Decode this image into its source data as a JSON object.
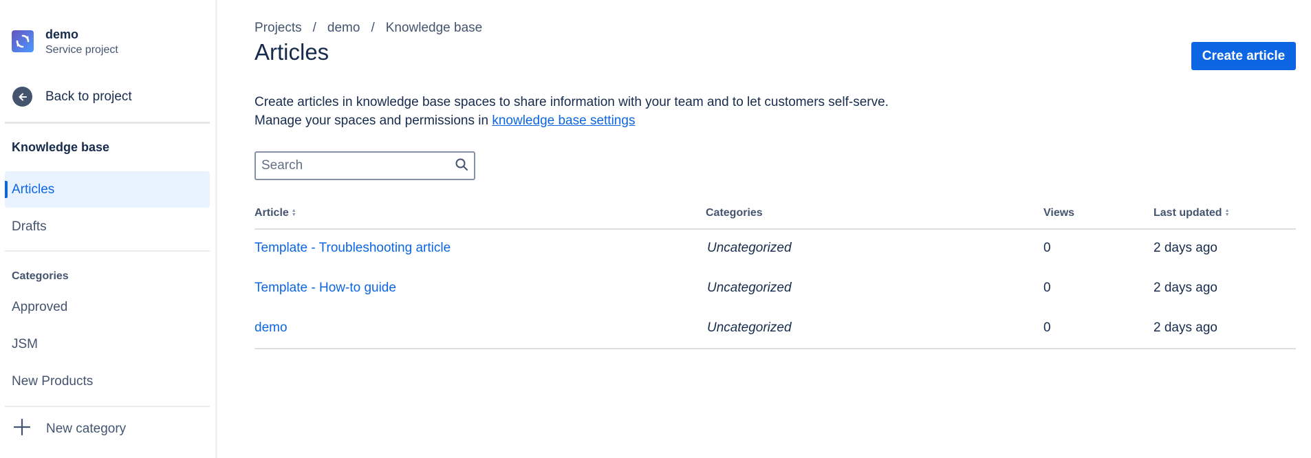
{
  "sidebar": {
    "project_name": "demo",
    "project_type": "Service project",
    "back_label": "Back to project",
    "section_title": "Knowledge base",
    "nav_items": [
      {
        "label": "Articles",
        "active": true
      },
      {
        "label": "Drafts",
        "active": false
      }
    ],
    "categories_title": "Categories",
    "categories": [
      "Approved",
      "JSM",
      "New Products"
    ],
    "new_category_label": "New category"
  },
  "breadcrumb": {
    "items": [
      "Projects",
      "demo",
      "Knowledge base"
    ],
    "separator": "/"
  },
  "page": {
    "title": "Articles",
    "create_button": "Create article",
    "description_line1": "Create articles in knowledge base spaces to share information with your team and to let customers self-serve.",
    "description_line2_prefix": "Manage your spaces and permissions in ",
    "description_link": "knowledge base settings"
  },
  "search": {
    "placeholder": "Search",
    "value": ""
  },
  "table": {
    "columns": [
      "Article",
      "Categories",
      "Views",
      "Last updated"
    ],
    "rows": [
      {
        "article": "Template - Troubleshooting article",
        "category": "Uncategorized",
        "views": "0",
        "updated": "2 days ago"
      },
      {
        "article": "Template - How-to guide",
        "category": "Uncategorized",
        "views": "0",
        "updated": "2 days ago"
      },
      {
        "article": "demo",
        "category": "Uncategorized",
        "views": "0",
        "updated": "2 days ago"
      }
    ]
  },
  "colors": {
    "accent": "#0c66e4",
    "active_bg": "#e9f2ff",
    "text": "#172b4d",
    "subtle_text": "#44546f"
  },
  "icons": {
    "project_logo": "project-logo-icon",
    "back": "arrow-left-icon",
    "search": "search-icon",
    "add": "plus-icon",
    "sort": "sort-icon"
  }
}
